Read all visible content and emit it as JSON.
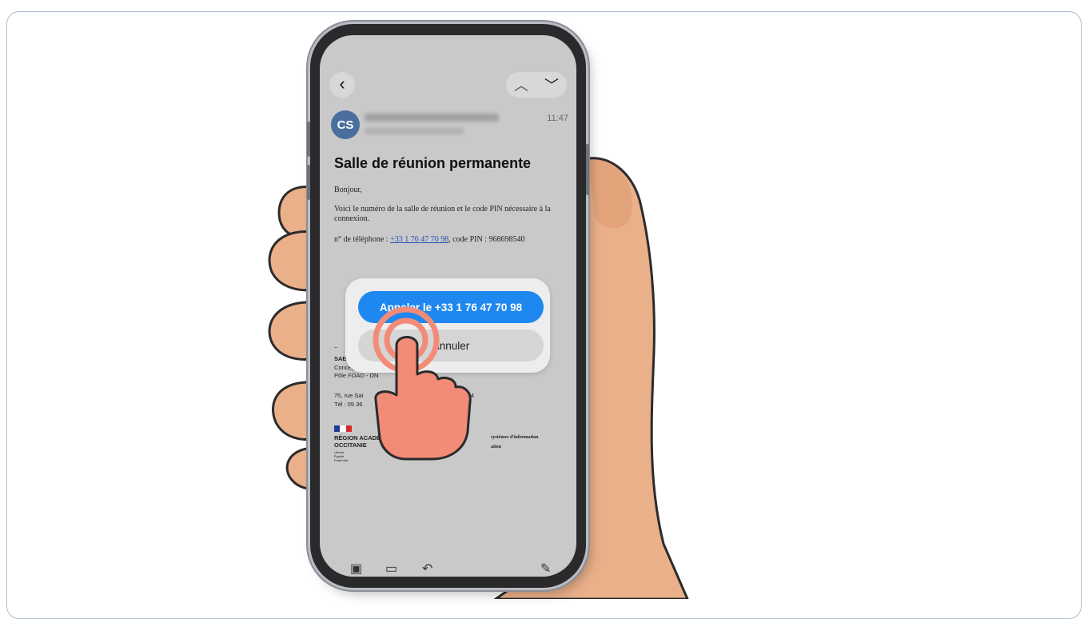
{
  "email": {
    "avatar_initials": "CS",
    "time": "11:47",
    "subject": "Salle de réunion permanente",
    "greeting": "Bonjour,",
    "intro": "Voici le numéro de la salle de réunion et le code PIN nécessaire à la connexion.",
    "phone_prefix": "n° de téléphone : ",
    "phone_number": "+33 1 76 47 70 98",
    "pin_text": ", code PIN : 968698540",
    "signature": {
      "dash": "–",
      "name": "SABI",
      "line1": "Conception",
      "line2": "Pôle FOAD - DN",
      "address": "75, rue Sai",
      "address_end": "E Cedex 4",
      "phone": "Tél : 05 36",
      "org1": "RÉGION ACADÉ",
      "org2": "OCCITANIE",
      "motto1": "Liberté",
      "motto2": "Égalité",
      "motto3": "Fraternité",
      "right1": "systèmes d'information",
      "right2": "ation"
    }
  },
  "dialog": {
    "call_label": "Appeler le +33 1 76 47 70 98",
    "cancel_label": "Annuler"
  },
  "colors": {
    "call_button": "#1e88f0",
    "tap_indicator": "#f28b78",
    "hand_skin": "#eab08a"
  },
  "icons": {
    "back": "chevron-left-icon",
    "up": "chevron-up-icon",
    "down": "chevron-down-icon",
    "archive": "archive-icon",
    "folder": "folder-icon",
    "reply": "reply-icon",
    "compose": "compose-icon"
  }
}
